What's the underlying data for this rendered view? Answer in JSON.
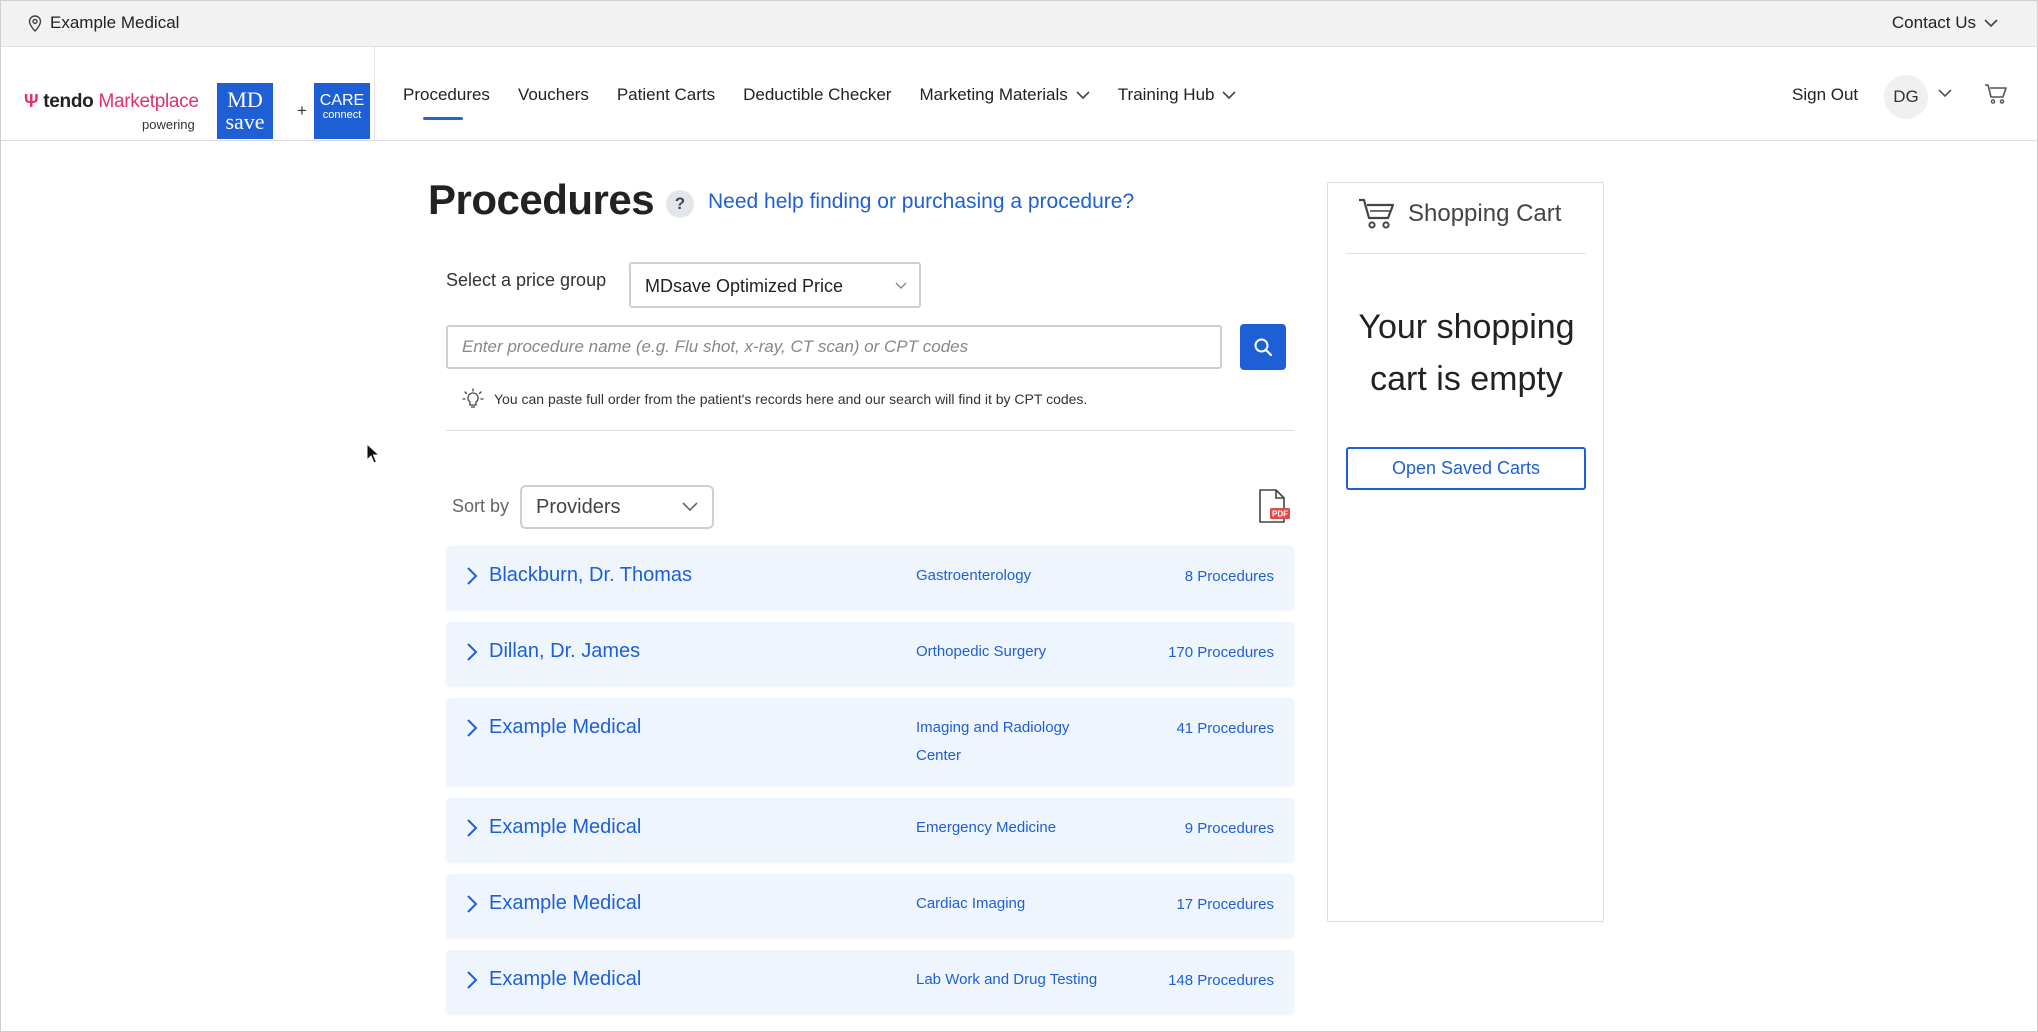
{
  "topbar": {
    "location": "Example Medical",
    "contact": "Contact Us"
  },
  "brand": {
    "tendo": "tendo",
    "marketplace": "Marketplace",
    "powering": "powering",
    "mdsave_top": "MD",
    "mdsave_bottom": "save",
    "plus": "+",
    "care_top": "CARE",
    "care_bottom": "connect",
    "accent": "#1f5fd6",
    "tendo_color": "#e0316c"
  },
  "nav": {
    "items": [
      {
        "label": "Procedures",
        "active": true
      },
      {
        "label": "Vouchers"
      },
      {
        "label": "Patient Carts"
      },
      {
        "label": "Deductible Checker"
      },
      {
        "label": "Marketing Materials",
        "dropdown": true
      },
      {
        "label": "Training Hub",
        "dropdown": true
      }
    ],
    "sign_out": "Sign Out",
    "avatar_initials": "DG"
  },
  "main": {
    "title": "Procedures",
    "help_icon": "?",
    "help_link": "Need help finding or purchasing a procedure?",
    "price_group_label": "Select a price group",
    "price_group_value": "MDsave Optimized Price",
    "search_placeholder": "Enter procedure name (e.g. Flu shot, x-ray, CT scan) or CPT codes",
    "hint": "You can paste full order from the patient's records here and our search will find it by CPT codes.",
    "sort_label": "Sort by",
    "sort_value": "Providers",
    "rows": [
      {
        "name": "Blackburn, Dr. Thomas",
        "specialty": "Gastroenterology",
        "count": "8 Procedures"
      },
      {
        "name": "Dillan, Dr. James",
        "specialty": "Orthopedic Surgery",
        "count": "170 Procedures"
      },
      {
        "name": "Example Medical",
        "specialty": "Imaging and Radiology Center",
        "count": "41 Procedures"
      },
      {
        "name": "Example Medical",
        "specialty": "Emergency Medicine",
        "count": "9 Procedures"
      },
      {
        "name": "Example Medical",
        "specialty": "Cardiac Imaging",
        "count": "17 Procedures"
      },
      {
        "name": "Example Medical",
        "specialty": "Lab Work and Drug Testing",
        "count": "148 Procedures"
      }
    ]
  },
  "cart": {
    "title": "Shopping Cart",
    "empty_message": "Your shopping cart is empty",
    "open_saved": "Open Saved Carts"
  }
}
